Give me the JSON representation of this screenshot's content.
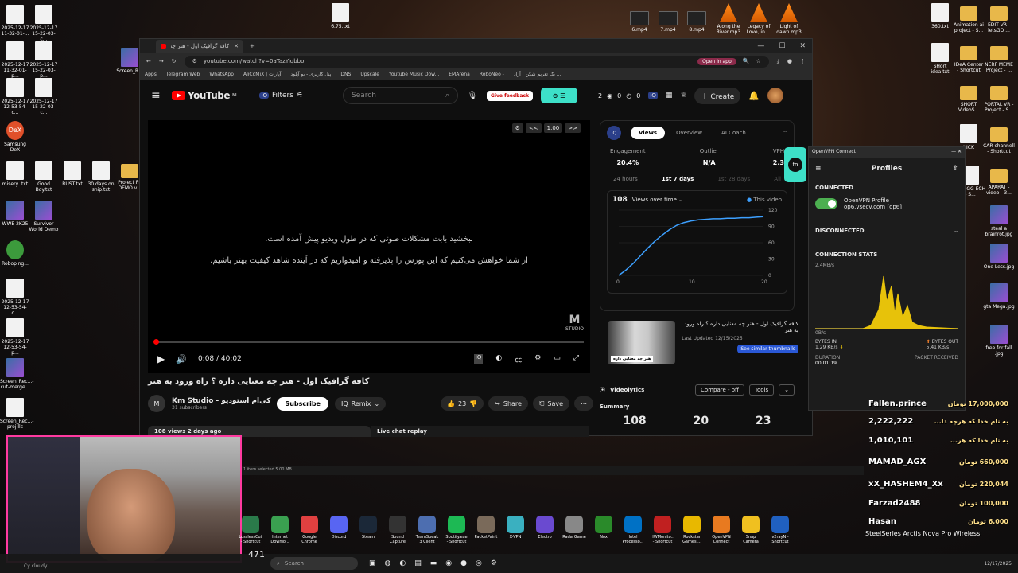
{
  "desktop": {
    "left_icons": [
      {
        "label": "2025-12-17 11-32-01-...",
        "type": "file"
      },
      {
        "label": "2025-12-17 15-22-03-c...",
        "type": "file"
      },
      {
        "label": "2025-12-17 11-32-01-p...",
        "type": "file"
      },
      {
        "label": "2025-12-17 15-22-03-p...",
        "type": "file"
      },
      {
        "label": "2025-12-17 12-53-54-c...",
        "type": "file"
      },
      {
        "label": "2025-12-17 15-22-03-c...",
        "type": "file"
      },
      {
        "label": "Samsung DeX",
        "type": "dex"
      },
      {
        "label": "misery .txt",
        "type": "file"
      },
      {
        "label": "Good Boy.txt",
        "type": "file"
      },
      {
        "label": "RUST.txt",
        "type": "file"
      },
      {
        "label": "30 days on ship.txt",
        "type": "file"
      },
      {
        "label": "Project PL DEMO v...",
        "type": "folder"
      },
      {
        "label": "WWE 2K25",
        "type": "img"
      },
      {
        "label": "Survivor World Demo",
        "type": "img"
      },
      {
        "label": "Roboping...",
        "type": "rob"
      },
      {
        "label": "2025-12-17 12-53-54-c...",
        "type": "file"
      },
      {
        "label": "2025-12-17 12-53-54-p...",
        "type": "file"
      },
      {
        "label": "Screen_Rec...-cut-merge...",
        "type": "img"
      },
      {
        "label": "Screen_Rec...-proj.llc",
        "type": "file"
      },
      {
        "label": "Screen_R...",
        "type": "img"
      }
    ],
    "top_icons": [
      {
        "label": "6.75.txt",
        "type": "file"
      },
      {
        "label": "6.mp4",
        "type": "vid"
      },
      {
        "label": "7.mp4",
        "type": "vid"
      },
      {
        "label": "8.mp4",
        "type": "vid"
      },
      {
        "label": "Along the River.mp3",
        "type": "vlc"
      },
      {
        "label": "Legacy of Love, in ...",
        "type": "vlc"
      },
      {
        "label": "Light of dawn.mp3",
        "type": "vlc"
      }
    ],
    "right_icons": [
      {
        "label": "360.txt",
        "type": "file"
      },
      {
        "label": "Animation ai project - S...",
        "type": "folder"
      },
      {
        "label": "EDIT VR - letsGO ...",
        "type": "folder"
      },
      {
        "label": "SHort idea.txt",
        "type": "file"
      },
      {
        "label": "IDeA Center - Shortcut",
        "type": "folder"
      },
      {
        "label": "NERF MEME Project - ...",
        "type": "folder"
      },
      {
        "label": "SHORT VideoS...",
        "type": "folder"
      },
      {
        "label": "PORTAL VR - Project - S...",
        "type": "folder"
      },
      {
        "label": "KICK",
        "type": "file"
      },
      {
        "label": "CAR channell - Shortcut",
        "type": "folder"
      },
      {
        "label": "DC EGG ECH - S...",
        "type": "file"
      },
      {
        "label": "APARAT - video - 3...",
        "type": "folder"
      },
      {
        "label": "steal a brainrot.jpg",
        "type": "img"
      },
      {
        "label": "One Less.jpg",
        "type": "img"
      },
      {
        "label": "gta Mega.jpg",
        "type": "img"
      },
      {
        "label": "free for fall .jpg",
        "type": "img"
      }
    ]
  },
  "browser": {
    "tab_title": "کافه گرافیک اول - هنر چه م...",
    "url": "youtube.com/watch?v=0aTazYiqbbo",
    "open_in_app": "Open in app",
    "bookmarks": [
      "Apps",
      "Telegram Web",
      "WhatsApp",
      "AliCoMiX | آپارات",
      "پنل کاربری - یو آپلود",
      "DNS",
      "Upscale",
      "Youtube Music Dow...",
      "EMArena",
      "RoboNeo -",
      "یک تعریم شکن | آزاد ..."
    ]
  },
  "youtube": {
    "logo": "YouTube",
    "logo_sup": "NL",
    "filters_label": "Filters",
    "search_placeholder": "Search",
    "feedback_label": "Give feedback",
    "stats": [
      "2",
      "0",
      "0"
    ],
    "create_label": "Create",
    "subtitle_line1": "ببخشید بابت مشکلات صوتی که در طول ویدیو پیش آمده است.",
    "subtitle_line2": "از شما خواهش می‌کنیم که این پوزش را پذیرفته و امیدواریم که در آینده شاهد کیفیت بهتر باشیم.",
    "speed": "1.00",
    "time": "0:08 / 40:02",
    "progress": 0.003,
    "studio_label": "STUDIO",
    "video_title": "کافه گرافیک اول - هنر چه معنایی داره ؟ راه ورود به هنر",
    "channel_name": "Km Studio - کی‌ام استودیو",
    "subscribers": "31 subscribers",
    "subscribe_label": "Subscribe",
    "remix_label": "Remix",
    "likes": "23",
    "share_label": "Share",
    "save_label": "Save",
    "desc_meta": "108 views  2 days ago",
    "live_chat": "Live chat replay"
  },
  "views_panel": {
    "tabs": [
      "Views",
      "Overview",
      "AI Coach"
    ],
    "metrics": [
      {
        "label": "Engagement",
        "value": "20.4%"
      },
      {
        "label": "Outlier",
        "value": "N/A"
      },
      {
        "label": "VPH",
        "value": "2.3"
      }
    ],
    "ranges": [
      "24 hours",
      "1st 7 days",
      "1st 28 days",
      "All"
    ],
    "total": "108",
    "dropdown": "Views over time",
    "legend": "This video",
    "chart_data": {
      "type": "line",
      "x": [
        0,
        1,
        2,
        3,
        4,
        5,
        6,
        7,
        8,
        9,
        10,
        11,
        12,
        13,
        14,
        15,
        16,
        17,
        18,
        19,
        20
      ],
      "series": [
        {
          "name": "This video",
          "values": [
            0,
            10,
            22,
            36,
            50,
            63,
            74,
            84,
            92,
            97,
            100,
            102,
            103,
            104,
            104,
            105,
            105,
            106,
            106,
            107,
            108
          ]
        }
      ],
      "xticks": [
        "0",
        "10",
        "20"
      ],
      "yticks": [
        "0",
        "30",
        "60",
        "90",
        "120"
      ],
      "ylim": [
        0,
        120
      ],
      "xlim": [
        0,
        20
      ]
    }
  },
  "thumb_card": {
    "title": "کافه گرافیک اول - هنر چه معنایی داره ؟ راه ورود به هنر",
    "updated": "Last Updated 12/15/2025",
    "thumb_text": "هنر چه معنایی داره",
    "similar": "See similar thumbnails"
  },
  "videolytics": {
    "name": "Videolytics",
    "compare": "Compare - off",
    "tools": "Tools",
    "summary": "Summary",
    "nums": [
      "108",
      "20",
      "23"
    ]
  },
  "vpn": {
    "window_title": "OpenVPN Connect",
    "title": "Profiles",
    "connected": "CONNECTED",
    "profile_name": "OpenVPN Profile",
    "profile_host": "op6.vsecv.com [op6]",
    "disconnected": "DISCONNECTED",
    "conn_stats": "CONNECTION STATS",
    "rate_top": "2.4MB/s",
    "rate_bottom": "0B/s",
    "bytes_in_label": "BYTES IN",
    "bytes_in": "1.29 KB/s",
    "bytes_out_label": "BYTES OUT",
    "bytes_out": "5.41 KB/s",
    "duration_label": "DURATION",
    "duration": "00:01:19",
    "packet_label": "PACKET RECEIVED"
  },
  "donations": [
    {
      "name": "Fallen.prince",
      "amount": "17,000,000 تومان"
    },
    {
      "name": "2,222,222",
      "amount": "به نام خدا که هرچه دا..."
    },
    {
      "name": "1,010,101",
      "amount": "به نام خدا که هر..."
    },
    {
      "name": "MAMAD_AGX",
      "amount": "660,000 تومان"
    },
    {
      "name": "xX_HASHEM4_Xx",
      "amount": "220,044 تومان"
    },
    {
      "name": "Farzad2488",
      "amount": "100,000 تومان"
    },
    {
      "name": "Hasan",
      "amount": "6,000 تومان"
    }
  ],
  "headset": "SteelSeries Arctis Nova Pro Wireless",
  "explorer_status": "1 item selected  5.00 MB",
  "taskbar_apps": [
    "LosslessCut - Shortcut",
    "Internet Downlo...",
    "Google Chrome",
    "Discord",
    "Steam",
    "Sound Capture",
    "TeamSpeak 3 Client",
    "Spotify.exe - Shortcut",
    "PacketPaint",
    "X-VPN",
    "Electro",
    "RadarGame",
    "Nox",
    "Intel Processo...",
    "HWMonito... - Shortcut",
    "Rockstar Games ...",
    "OpenVPN Connect",
    "Snap Camera",
    "v2rayN - Shortcut"
  ],
  "taskbar_search": "Search",
  "taskbar_num": "471",
  "tray_date": "12/17/2025",
  "cursor_note": "Cy cloudy"
}
